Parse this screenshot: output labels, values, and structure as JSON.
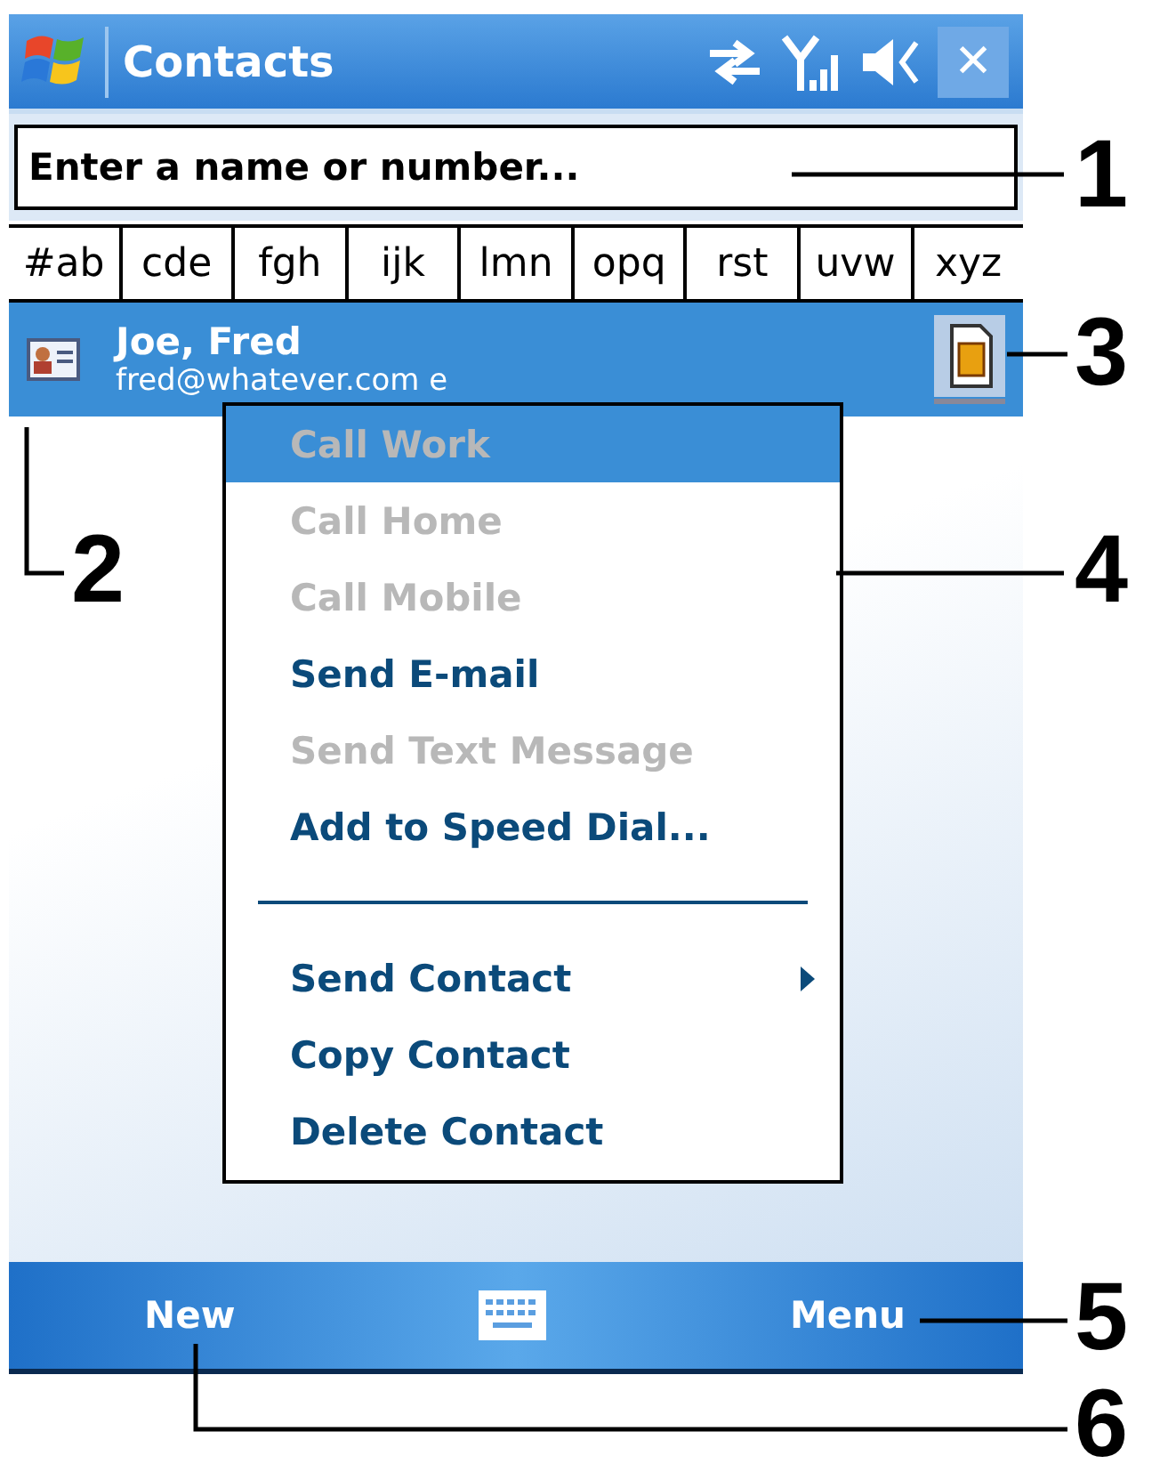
{
  "title_bar": {
    "title": "Contacts",
    "close": "✕"
  },
  "search": {
    "placeholder": "Enter a name or number..."
  },
  "alpha_tabs": [
    {
      "label": "#ab",
      "selected": false
    },
    {
      "label": "cde",
      "selected": false
    },
    {
      "label": "fgh",
      "selected": false
    },
    {
      "label": "ijk",
      "selected": false
    },
    {
      "label": "lmn",
      "selected": false
    },
    {
      "label": "opq",
      "selected": false
    },
    {
      "label": "rst",
      "selected": false
    },
    {
      "label": "uvw",
      "selected": false
    },
    {
      "label": "xyz",
      "selected": false
    }
  ],
  "contacts": [
    {
      "name": "Joe, Fred",
      "detail": "fred@whatever.com   e",
      "selected": true
    }
  ],
  "context_menu": [
    {
      "kind": "item",
      "label": "Call Work",
      "disabled": true,
      "selected": true,
      "submenu": false
    },
    {
      "kind": "item",
      "label": "Call Home",
      "disabled": true,
      "selected": false,
      "submenu": false
    },
    {
      "kind": "item",
      "label": "Call Mobile",
      "disabled": true,
      "selected": false,
      "submenu": false
    },
    {
      "kind": "item",
      "label": "Send E-mail",
      "disabled": false,
      "selected": false,
      "submenu": false
    },
    {
      "kind": "item",
      "label": "Send Text Message",
      "disabled": true,
      "selected": false,
      "submenu": false
    },
    {
      "kind": "item",
      "label": "Add to Speed Dial...",
      "disabled": false,
      "selected": false,
      "submenu": false
    },
    {
      "kind": "separator"
    },
    {
      "kind": "item",
      "label": "Send Contact",
      "disabled": false,
      "selected": false,
      "submenu": true
    },
    {
      "kind": "item",
      "label": "Copy Contact",
      "disabled": false,
      "selected": false,
      "submenu": false
    },
    {
      "kind": "item",
      "label": "Delete Contact",
      "disabled": false,
      "selected": false,
      "submenu": false
    }
  ],
  "soft_keys": {
    "left": "New",
    "right": "Menu"
  },
  "callouts": [
    {
      "label": "1"
    },
    {
      "label": "3"
    },
    {
      "label": "2"
    },
    {
      "label": "4"
    },
    {
      "label": "5"
    },
    {
      "label": "6"
    }
  ]
}
